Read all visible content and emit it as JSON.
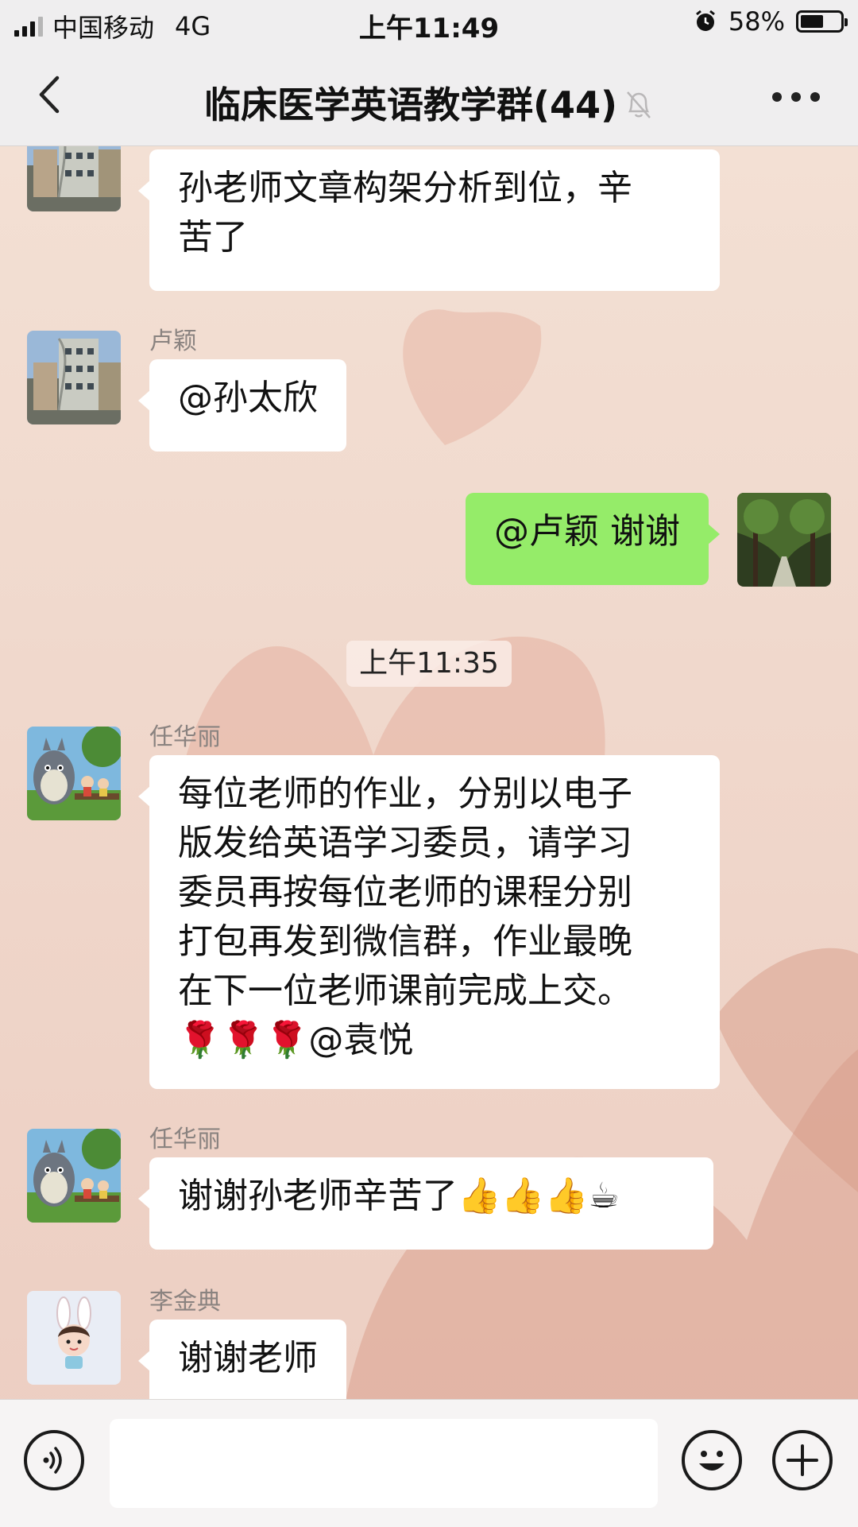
{
  "status_bar": {
    "carrier": "中国移动",
    "network": "4G",
    "time": "上午11:49",
    "battery": "58%",
    "battery_level": 0.58
  },
  "nav": {
    "title": "临床医学英语教学群(44)",
    "back_icon": "chevron-left-icon",
    "mute_icon": "bell-muted-icon",
    "more_icon": "more-dots-icon"
  },
  "messages": [
    {
      "sender": "",
      "text": "孙老师文章构架分析到位，辛\n苦了",
      "avatar": "building-photo"
    },
    {
      "sender": "卢颖",
      "text": "@孙太欣",
      "avatar": "building-photo"
    },
    {
      "sender": "self",
      "text": "@卢颖 谢谢",
      "avatar": "tree-avenue-photo"
    },
    {
      "timestamp": "上午11:35"
    },
    {
      "sender": "任华丽",
      "text": "每位老师的作业，分别以电子\n版发给英语学习委员，请学习\n委员再按每位老师的课程分别\n打包再发到微信群，作业最晚\n在下一位老师课前完成上交。\n🌹🌹🌹@袁悦",
      "avatar": "totoro-cartoon"
    },
    {
      "sender": "任华丽",
      "text": "谢谢孙老师辛苦了👍👍👍☕",
      "avatar": "totoro-cartoon"
    },
    {
      "sender": "李金典",
      "text": "谢谢老师",
      "avatar": "bunny-cartoon"
    }
  ],
  "input_bar": {
    "voice_icon": "voice-icon",
    "emoji_icon": "emoji-icon",
    "plus_icon": "plus-icon",
    "placeholder": ""
  },
  "colors": {
    "self_bubble": "#95ec69",
    "other_bubble": "#ffffff",
    "bar_bg": "#efeeef"
  }
}
